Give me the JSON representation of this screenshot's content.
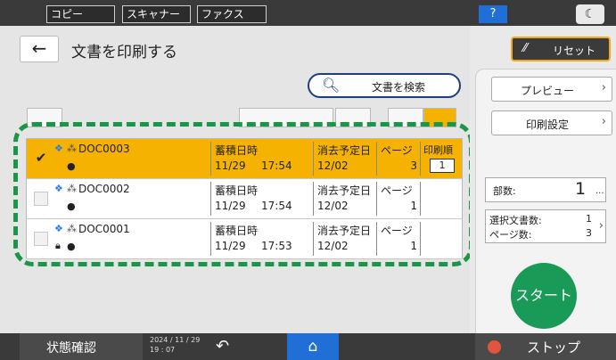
{
  "top_tabs": [
    "コピー",
    "スキャナー",
    "ファクス"
  ],
  "help_label": "?",
  "header": {
    "title": "文書を印刷する",
    "back_icon": "←",
    "reset_label": "リセット"
  },
  "search": {
    "label": "文書を検索"
  },
  "documents": [
    {
      "name": "DOC0003",
      "selected": true,
      "lock": false,
      "stored_label": "蓄積日時",
      "stored_date": "11/29",
      "stored_time": "17:54",
      "delete_label": "消去予定日",
      "delete_date": "12/02",
      "pages_label": "ページ",
      "pages": "3",
      "order_label": "印刷順",
      "order": "1"
    },
    {
      "name": "DOC0002",
      "selected": false,
      "lock": false,
      "stored_label": "蓄積日時",
      "stored_date": "11/29",
      "stored_time": "17:54",
      "delete_label": "消去予定日",
      "delete_date": "12/02",
      "pages_label": "ページ",
      "pages": "1"
    },
    {
      "name": "DOC0001",
      "selected": false,
      "lock": true,
      "stored_label": "蓄積日時",
      "stored_date": "11/29",
      "stored_time": "17:53",
      "delete_label": "消去予定日",
      "delete_date": "12/02",
      "pages_label": "ページ",
      "pages": "1"
    }
  ],
  "right_panel": {
    "preview_label": "プレビュー",
    "print_settings_label": "印刷設定",
    "copies_label": "部数:",
    "copies_value": "1",
    "copies_more": "...",
    "selected_docs_label": "選択文書数:",
    "selected_docs_value": "1",
    "page_count_label": "ページ数:",
    "page_count_value": "3",
    "start_label": "スタート"
  },
  "bottom": {
    "status_label": "状態確認",
    "clock_date": "2024 / 11 / 29",
    "clock_time": "19 : 07",
    "stop_label": "ストップ"
  },
  "colors": {
    "accent": "#f5b200",
    "highlight": "#1a9648",
    "start": "#199a56",
    "home": "#1f6fd6"
  }
}
